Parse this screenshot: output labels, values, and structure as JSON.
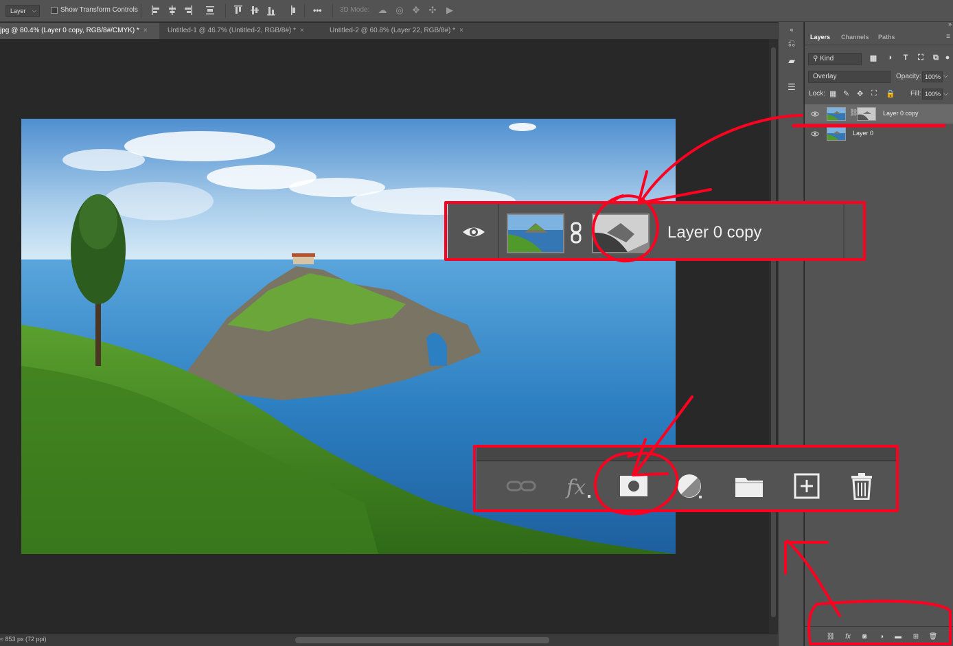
{
  "options_bar": {
    "auto_select_value": "Layer",
    "show_transform_label": "Show Transform Controls",
    "mode_3d_label": "3D Mode:"
  },
  "tabs": [
    {
      "label": "jpg @ 80.4% (Layer 0 copy, RGB/8#/CMYK) *"
    },
    {
      "label": "Untitled-1 @ 46.7% (Untitled-2, RGB/8#) *"
    },
    {
      "label": "Untitled-2 @ 60.8% (Layer 22, RGB/8#) *"
    }
  ],
  "status_bar": {
    "text": "≈ 853 px (72 ppi)"
  },
  "layers_panel": {
    "tabs": [
      "Layers",
      "Channels",
      "Paths"
    ],
    "filter_kind": "Kind",
    "blend_mode": "Overlay",
    "opacity_label": "Opacity:",
    "opacity_value": "100%",
    "lock_label": "Lock:",
    "fill_label": "Fill:",
    "fill_value": "100%",
    "layers": [
      {
        "name": "Layer 0 copy",
        "selected": true,
        "has_mask": true
      },
      {
        "name": "Layer 0",
        "selected": false,
        "has_mask": false
      }
    ]
  },
  "callout_layer": {
    "name": "Layer 0 copy"
  },
  "callout_buttons": [
    "link-layers",
    "add-layer-style",
    "add-layer-mask",
    "new-fill-adjustment-layer",
    "new-group",
    "new-layer",
    "delete-layer"
  ],
  "colors": {
    "annotation_red": "#ff0020",
    "panel_bg": "#535353",
    "canvas_bg": "#282828"
  }
}
